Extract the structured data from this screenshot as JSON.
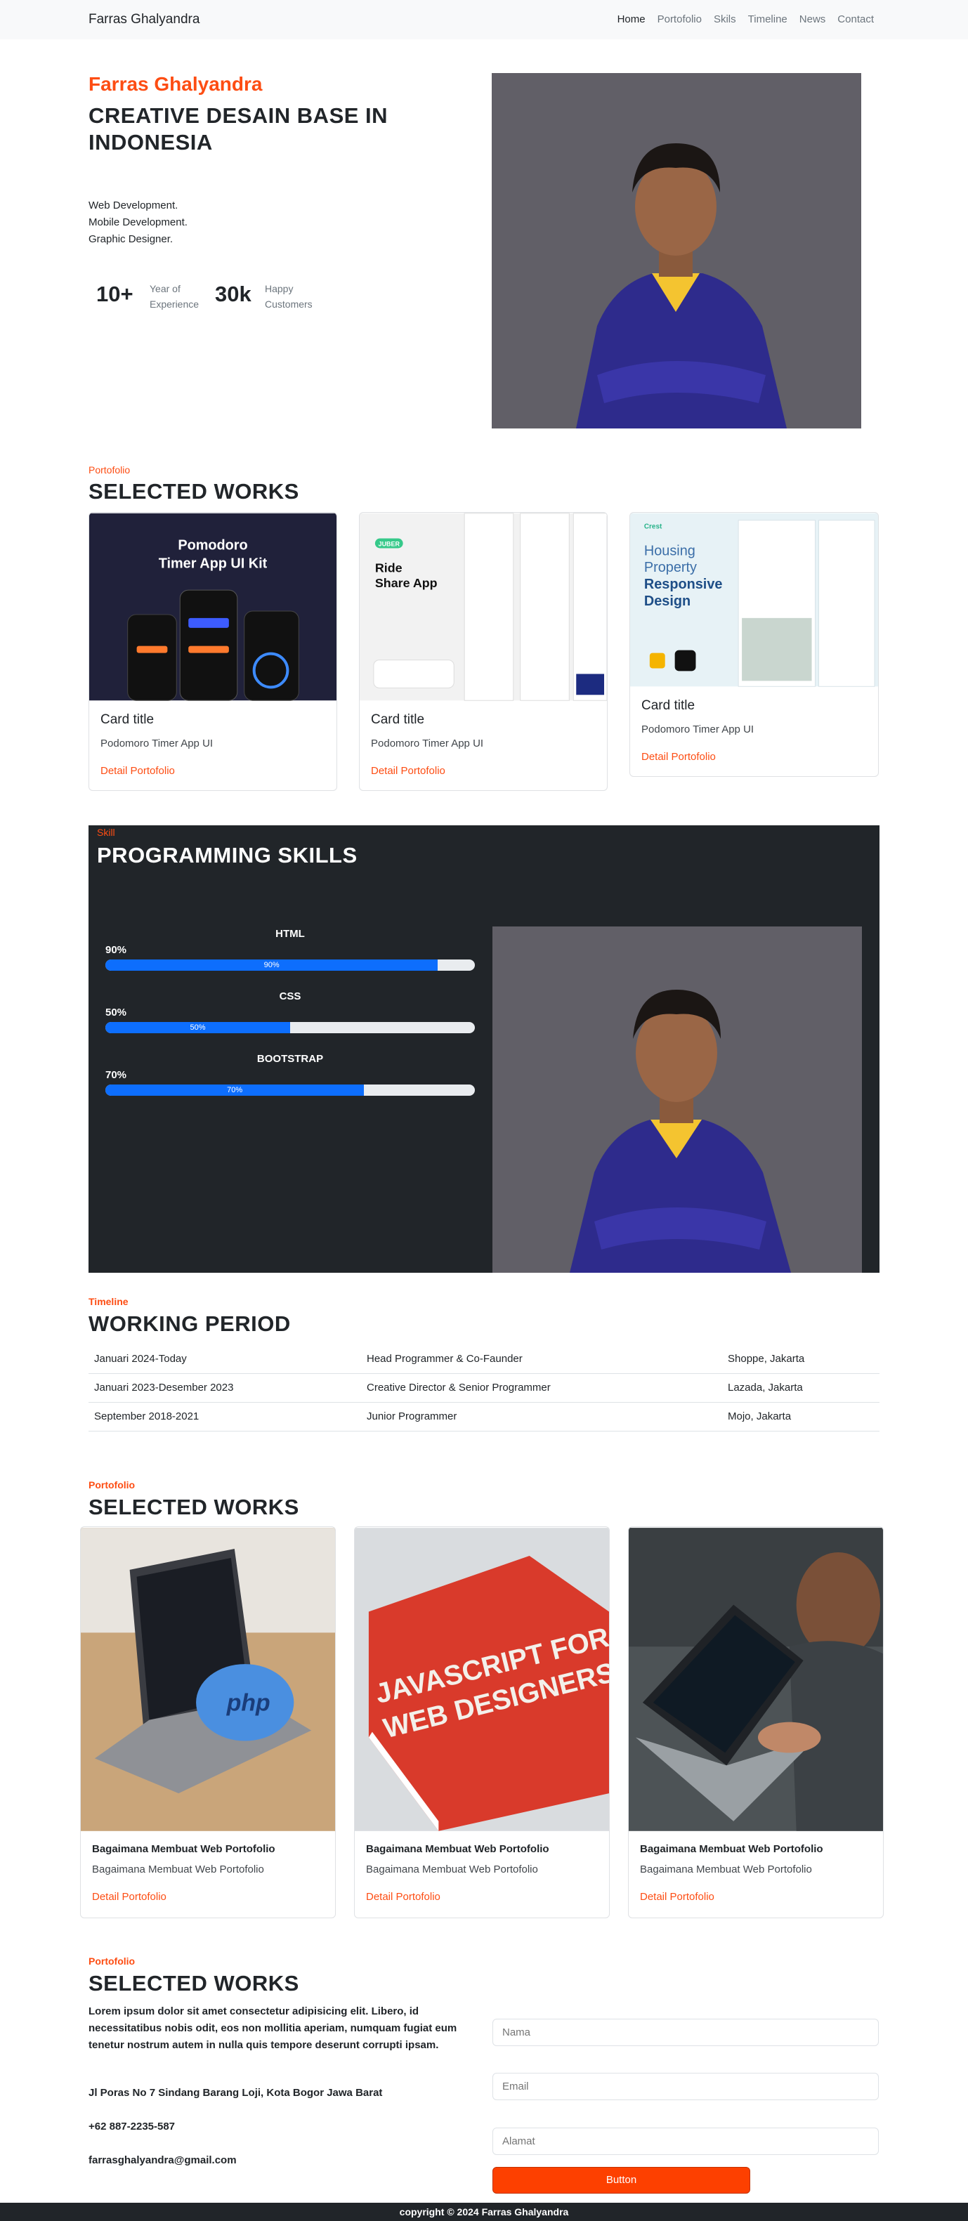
{
  "navbar": {
    "brand": "Farras Ghalyandra",
    "links": [
      "Home",
      "Portofolio",
      "Skils",
      "Timeline",
      "News",
      "Contact"
    ]
  },
  "hero": {
    "name": "Farras Ghalyandra",
    "title": "CREATIVE DESAIN BASE IN INDONESIA",
    "roles": [
      "Web Development.",
      "Mobile Development.",
      "Graphic Designer."
    ],
    "stats": [
      {
        "value": "10+",
        "label_line1": "Year of",
        "label_line2": "Experience"
      },
      {
        "value": "30k",
        "label_line1": "Happy",
        "label_line2": "Customers"
      }
    ]
  },
  "works1": {
    "eyebrow": "Portofolio",
    "title": "SELECTED WORKS",
    "cards": [
      {
        "image_title_line1": "Pomodoro",
        "image_title_line2": "Timer App UI  Kit",
        "title": "Card title",
        "text": "Podomoro Timer App UI",
        "link": "Detail Portofolio"
      },
      {
        "image_badge": "JUBER",
        "image_title_line1": "Ride",
        "image_title_line2": "Share App",
        "title": "Card title",
        "text": "Podomoro Timer App UI",
        "link": "Detail Portofolio"
      },
      {
        "image_brand": "Crest",
        "image_title_line1": "Housing",
        "image_title_line2": "Property",
        "image_title_line3": "Responsive",
        "image_title_line4": "Design",
        "title": "Card title",
        "text": "Podomoro Timer App UI",
        "link": "Detail Portofolio"
      }
    ]
  },
  "skills": {
    "eyebrow": "Skill",
    "title": "PROGRAMMING SKILLS",
    "items": [
      {
        "name": "HTML",
        "percent_label": "90%",
        "value": 90
      },
      {
        "name": "CSS",
        "percent_label": "50%",
        "value": 50
      },
      {
        "name": "BOOTSTRAP",
        "percent_label": "70%",
        "value": 70
      }
    ]
  },
  "timeline": {
    "eyebrow": "Timeline",
    "title": "WORKING PERIOD",
    "rows": [
      {
        "period": "Januari 2024-Today",
        "role": "Head Programmer & Co-Faunder",
        "place": "Shoppe, Jakarta"
      },
      {
        "period": "Januari 2023-Desember 2023",
        "role": "Creative Director & Senior Programmer",
        "place": "Lazada, Jakarta"
      },
      {
        "period": "September 2018-2021",
        "role": "Junior Programmer",
        "place": "Mojo, Jakarta"
      }
    ]
  },
  "works2": {
    "eyebrow": "Portofolio",
    "title": "SELECTED WORKS",
    "cards": [
      {
        "title": "Bagaimana Membuat Web Portofolio",
        "text": "Bagaimana Membuat Web Portofolio",
        "link": "Detail Portofolio"
      },
      {
        "title": "Bagaimana Membuat Web Portofolio",
        "text": "Bagaimana Membuat Web Portofolio",
        "link": "Detail Portofolio",
        "image_text_line1": "JAVASCRIPT FOR",
        "image_text_line2": "WEB DESIGNERS"
      },
      {
        "title": "Bagaimana Membuat Web Portofolio",
        "text": "Bagaimana Membuat Web Portofolio",
        "link": "Detail Portofolio"
      }
    ]
  },
  "contact": {
    "eyebrow": "Portofolio",
    "title": "SELECTED WORKS",
    "description": "Lorem ipsum dolor sit amet consectetur adipisicing elit. Libero, id necessitatibus nobis odit, eos non mollitia aperiam, numquam fugiat eum tenetur nostrum autem in nulla quis tempore deserunt corrupti ipsam.",
    "address": "Jl Poras No 7 Sindang Barang Loji, Kota Bogor Jawa Barat",
    "phone": "+62 887-2235-587",
    "email": "farrasghalyandra@gmail.com",
    "form": {
      "name_placeholder": "Nama",
      "email_placeholder": "Email",
      "address_placeholder": "Alamat",
      "button": "Button"
    }
  },
  "footer": {
    "text": "copyright © 2024 Farras Ghalyandra"
  },
  "colors": {
    "accent": "#fd4d13",
    "progress": "#0d6efd",
    "dark": "#212529",
    "button": "#fd4000"
  }
}
